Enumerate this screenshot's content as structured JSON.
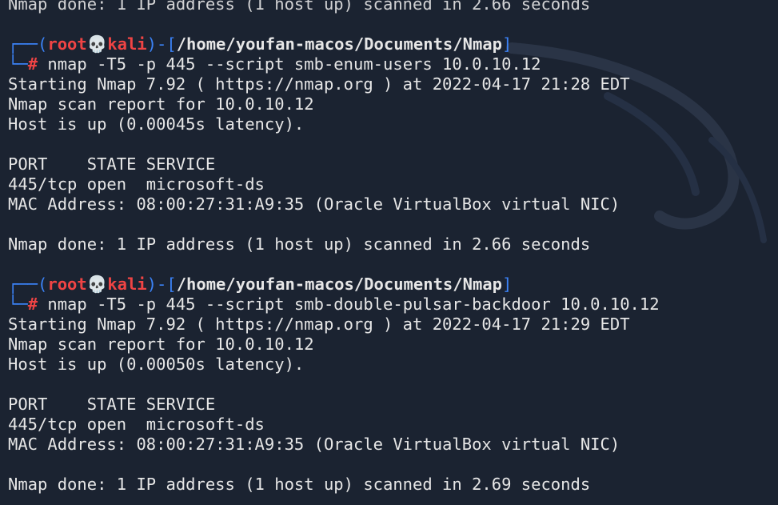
{
  "terminal": {
    "top_partial": "Nmap done: 1 IP address (1 host up) scanned in 2.66 seconds",
    "sessions": [
      {
        "user": "root",
        "host": "kali",
        "cwd": "/home/youfan-macos/Documents/Nmap",
        "command": "nmap -T5 -p 445 --script smb-enum-users 10.0.10.12",
        "starting": "Starting Nmap 7.92 ( https://nmap.org ) at 2022-04-17 21:28 EDT",
        "report": "Nmap scan report for 10.0.10.12",
        "hostup": "Host is up (0.00045s latency).",
        "header": "PORT    STATE SERVICE",
        "port_line": "445/tcp open  microsoft-ds",
        "mac": "MAC Address: 08:00:27:31:A9:35 (Oracle VirtualBox virtual NIC)",
        "done": "Nmap done: 1 IP address (1 host up) scanned in 2.66 seconds"
      },
      {
        "user": "root",
        "host": "kali",
        "cwd": "/home/youfan-macos/Documents/Nmap",
        "command": "nmap -T5 -p 445 --script smb-double-pulsar-backdoor 10.0.10.12",
        "starting": "Starting Nmap 7.92 ( https://nmap.org ) at 2022-04-17 21:29 EDT",
        "report": "Nmap scan report for 10.0.10.12",
        "hostup": "Host is up (0.00050s latency).",
        "header": "PORT    STATE SERVICE",
        "port_line": "445/tcp open  microsoft-ds",
        "mac": "MAC Address: 08:00:27:31:A9:35 (Oracle VirtualBox virtual NIC)",
        "done": "Nmap done: 1 IP address (1 host up) scanned in 2.69 seconds"
      }
    ]
  },
  "colors": {
    "background": "#1b2331",
    "prompt_frame": "#3b82f6",
    "prompt_user": "#ef4444",
    "text": "#e6e6e6"
  },
  "icons": {
    "prompt_separator": "skull-icon",
    "background_logo": "kali-dragon-icon"
  }
}
